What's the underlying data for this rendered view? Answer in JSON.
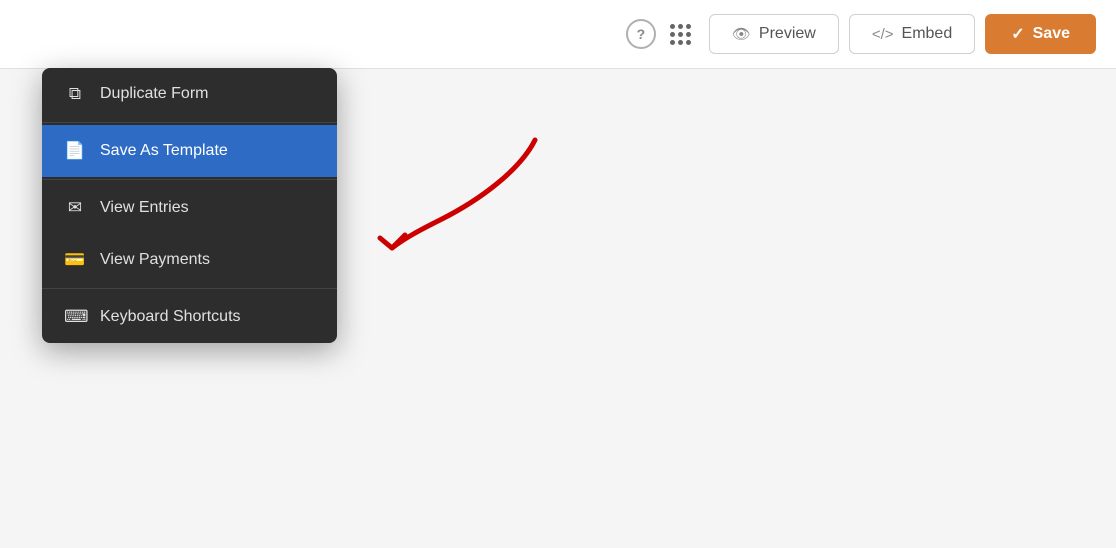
{
  "topbar": {
    "help_icon": "?",
    "preview_label": "Preview",
    "embed_label": "Embed",
    "save_label": "Save"
  },
  "menu": {
    "items": [
      {
        "id": "duplicate-form",
        "label": "Duplicate Form",
        "icon": "duplicate",
        "active": false
      },
      {
        "id": "save-as-template",
        "label": "Save As Template",
        "icon": "template",
        "active": true
      },
      {
        "id": "view-entries",
        "label": "View Entries",
        "icon": "entries",
        "active": false
      },
      {
        "id": "view-payments",
        "label": "View Payments",
        "icon": "payments",
        "active": false
      },
      {
        "id": "keyboard-shortcuts",
        "label": "Keyboard Shortcuts",
        "icon": "keyboard",
        "active": false
      }
    ]
  },
  "colors": {
    "save_button_bg": "#d97b30",
    "active_item_bg": "#2d6bc4",
    "menu_bg": "#2d2d2d",
    "arrow_color": "#cc0000"
  }
}
